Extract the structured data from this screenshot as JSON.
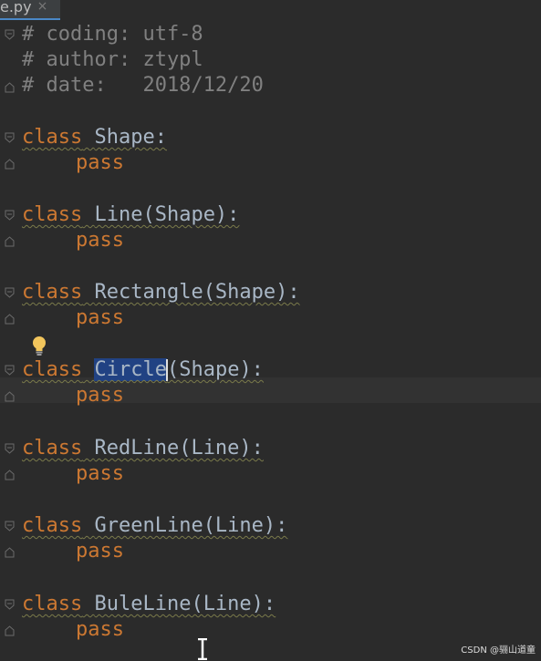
{
  "tab": {
    "filename": "e.py",
    "close_glyph": "×"
  },
  "code": {
    "line1": "# coding: utf-8",
    "line2": "# author: ztypl",
    "line3": "# date:   2018/12/20",
    "kw_class": "class",
    "kw_pass": "pass",
    "shape_decl": "Shape:",
    "line_decl": "Line(Shape):",
    "rectangle_decl": "Rectangle(Shape):",
    "circle_name": "Circle",
    "circle_rest": "(Shape):",
    "redline_decl": "RedLine(Line):",
    "greenline_decl": "GreenLine(Line):",
    "buleline_decl": "BuleLine(Line):"
  },
  "icons": {
    "fold": "fold-marker-icon",
    "bulb": "lightbulb-icon",
    "cursor": "text-cursor-icon"
  },
  "colors": {
    "background": "#2b2b2b",
    "keyword": "#cc7832",
    "comment": "#808080",
    "identifier": "#a9b7c6",
    "selection": "#214283"
  },
  "watermark": "CSDN @骊山道童"
}
